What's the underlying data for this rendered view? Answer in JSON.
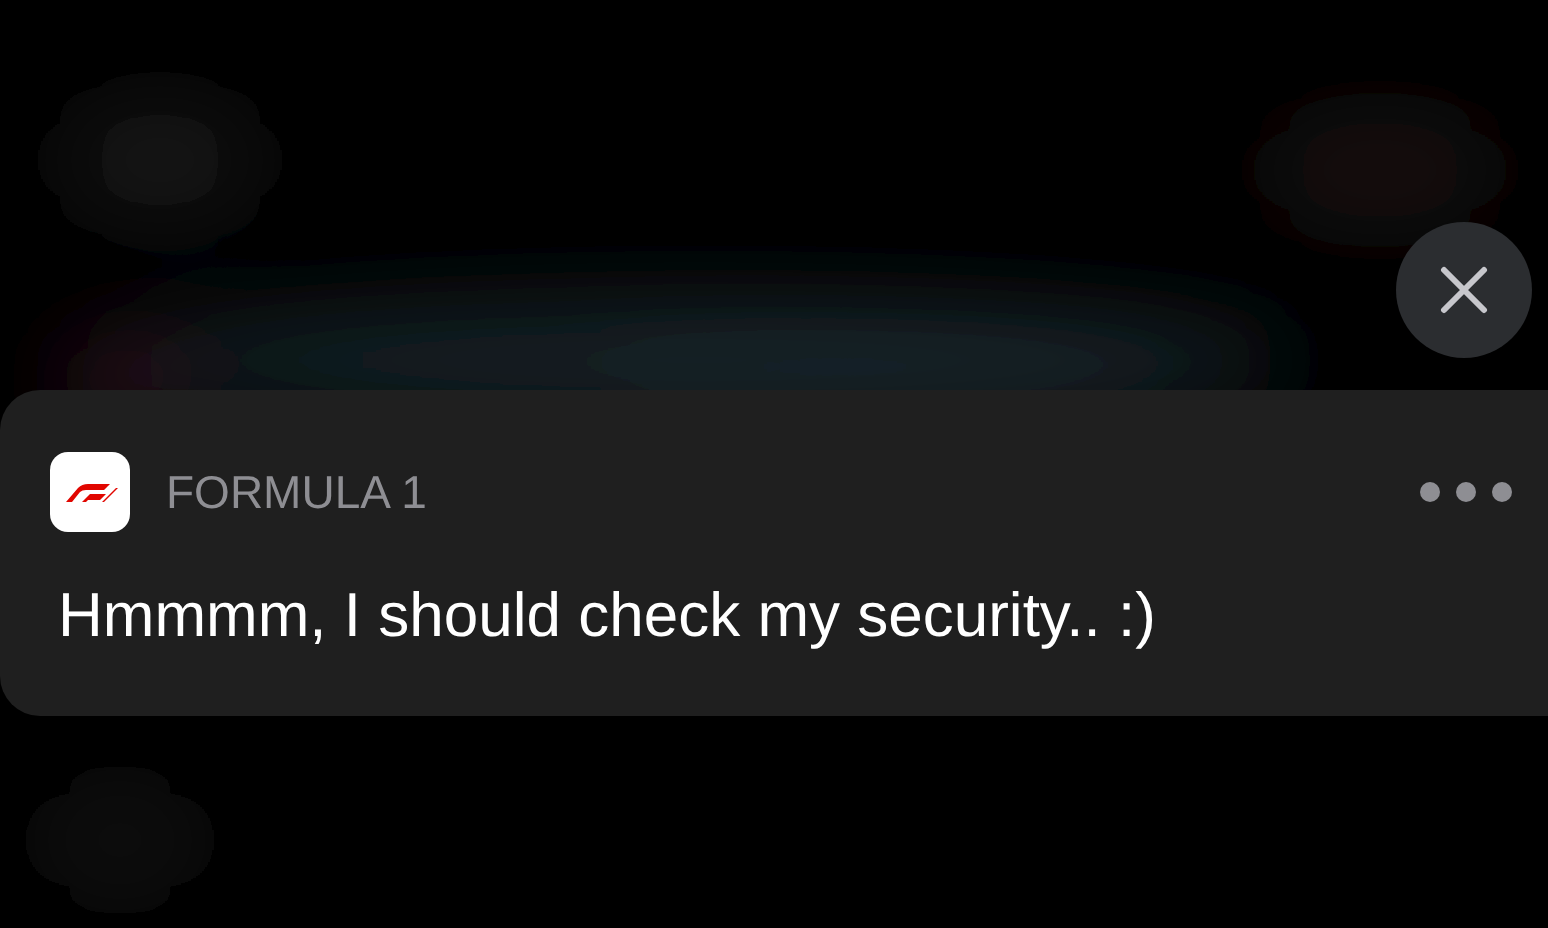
{
  "notification": {
    "app_name": "FORMULA 1",
    "message": "Hmmmm, I should check my security.. :)"
  }
}
